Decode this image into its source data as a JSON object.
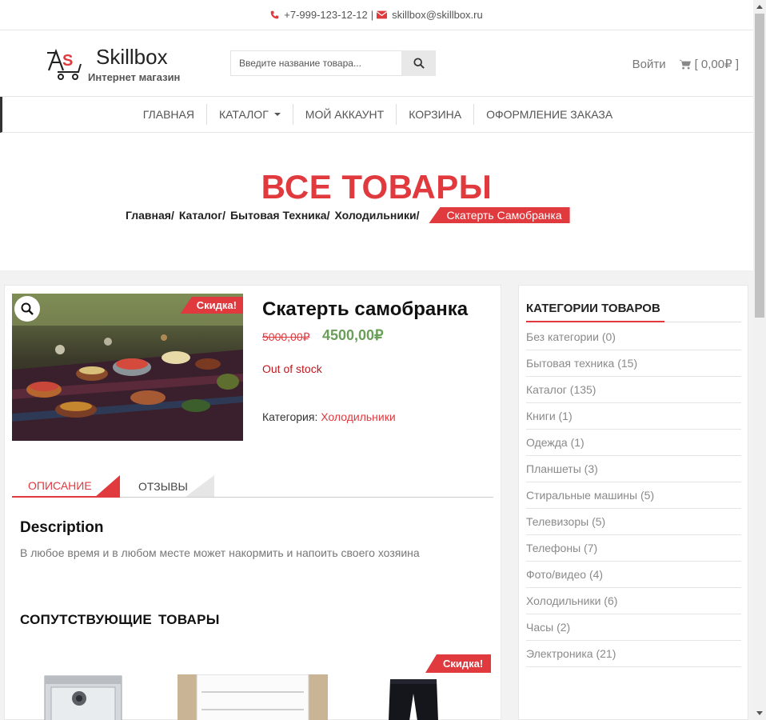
{
  "topbar": {
    "phone": "+7-999-123-12-12",
    "separator": "|",
    "email": "skillbox@skillbox.ru"
  },
  "header": {
    "brand": "Skillbox",
    "tagline": "Интернет магазин",
    "search_placeholder": "Введите название товара...",
    "login": "Войти",
    "cart": "[ 0,00₽ ]"
  },
  "nav": {
    "items": [
      "ГЛАВНАЯ",
      "КАТАЛОГ",
      "МОЙ АККАУНТ",
      "КОРЗИНА",
      "ОФОРМЛЕНИЕ ЗАКАЗА"
    ]
  },
  "hero": {
    "title": "ВСЕ ТОВАРЫ",
    "breadcrumbs": [
      "Главная",
      "Каталог",
      "Бытовая Техника",
      "Холодильники"
    ],
    "crumb_sep": "/",
    "current": "Скатерть Самобранка"
  },
  "product": {
    "badge": "Скидка!",
    "title": "Скатерть самобранка",
    "old_price": "5000,00₽",
    "new_price": "4500,00₽",
    "stock": "Out of stock",
    "category_label": "Категория:",
    "category": "Холодильники"
  },
  "tabs": {
    "description": "ОПИСАНИЕ",
    "reviews": "ОТЗЫВЫ"
  },
  "description": {
    "heading": "Description",
    "text": "В любое время и в любом месте может накормить и напоить своего хозяина"
  },
  "related": {
    "heading": "СОПУТСТВУЮЩИЕ  ТОВАРЫ",
    "badge": "Скидка!"
  },
  "sidebar": {
    "heading": "КАТЕГОРИИ ТОВАРОВ",
    "items": [
      "Без категории (0)",
      "Бытовая техника (15)",
      "Каталог (135)",
      "Книги (1)",
      "Одежда (1)",
      "Планшеты (3)",
      "Стиральные машины (5)",
      "Телевизоры (5)",
      "Телефоны (7)",
      "Фото/видео (4)",
      "Холодильники (6)",
      "Часы (2)",
      "Электроника (21)"
    ]
  },
  "colors": {
    "accent": "#e0393e",
    "price_green": "#6a9e5a"
  }
}
